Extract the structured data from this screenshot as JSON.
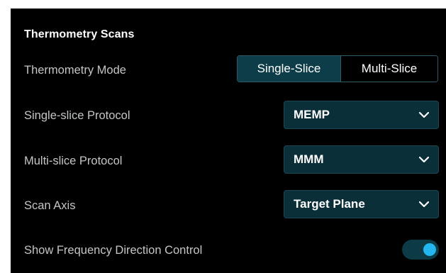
{
  "section": {
    "title": "Thermometry Scans"
  },
  "thermometry_mode": {
    "label": "Thermometry Mode",
    "options": [
      "Single-Slice",
      "Multi-Slice"
    ],
    "selected": "Single-Slice"
  },
  "single_slice_protocol": {
    "label": "Single-slice Protocol",
    "value": "MEMP"
  },
  "multi_slice_protocol": {
    "label": "Multi-slice Protocol",
    "value": "MMM"
  },
  "scan_axis": {
    "label": "Scan Axis",
    "value": "Target Plane"
  },
  "frequency_direction": {
    "label": "Show Frequency Direction Control",
    "enabled": true
  },
  "colors": {
    "background": "#000000",
    "select_background": "#0a2f38",
    "segment_active": "#0d3d49",
    "toggle_knob": "#22b5ef",
    "label_text": "#c3c5c7"
  },
  "icons": {
    "dropdown": "chevron-down-icon"
  }
}
